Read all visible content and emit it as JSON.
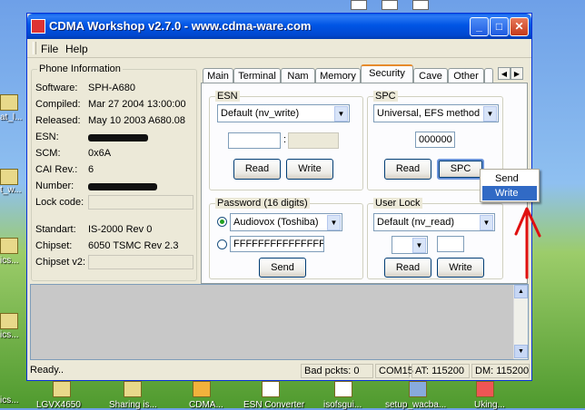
{
  "window": {
    "title": "CDMA Workshop v2.7.0  -  www.cdma-ware.com",
    "min_glyph": "_",
    "max_glyph": "□",
    "close_glyph": "✕"
  },
  "menu": {
    "file": "File",
    "help": "Help"
  },
  "phone_info": {
    "title": "Phone Information",
    "rows": [
      {
        "label": "Software:",
        "value": "SPH-A680"
      },
      {
        "label": "Compiled:",
        "value": "Mar 27 2004 13:00:00"
      },
      {
        "label": "Released:",
        "value": "May 10 2003 A680.08"
      },
      {
        "label": "ESN:",
        "value": ""
      },
      {
        "label": "SCM:",
        "value": "0x6A"
      },
      {
        "label": "CAI Rev.:",
        "value": "6"
      },
      {
        "label": "Number:",
        "value": ""
      },
      {
        "label": "Lock code:",
        "value": ""
      },
      {
        "label": "Standart:",
        "value": "IS-2000 Rev 0"
      },
      {
        "label": "Chipset:",
        "value": "6050 TSMC Rev 2.3"
      },
      {
        "label": "Chipset v2:",
        "value": ""
      }
    ]
  },
  "tabs": [
    "Main",
    "Terminal",
    "Nam",
    "Memory",
    "Security",
    "Cave",
    "Other"
  ],
  "active_tab": "Security",
  "tab_scroll": {
    "left": "◀",
    "right": "▶"
  },
  "esn_group": {
    "title": "ESN",
    "mode_selected": "Default (nv_write)",
    "separator": ":",
    "read_label": "Read",
    "write_label": "Write"
  },
  "spc_group": {
    "title": "SPC",
    "method_selected": "Universal, EFS method",
    "spc_value": "000000",
    "read_label": "Read",
    "spc_label": "SPC"
  },
  "password_group": {
    "title": "Password (16 digits)",
    "preset_selected": "Audiovox (Toshiba)",
    "custom_value": "FFFFFFFFFFFFFFFF",
    "send_label": "Send"
  },
  "user_lock_group": {
    "title": "User Lock",
    "mode_selected": "Default (nv_read)",
    "read_label": "Read",
    "write_label": "Write"
  },
  "context_menu": {
    "items": [
      "Send",
      "Write"
    ],
    "selected": "Write"
  },
  "statusbar": {
    "status": "Ready..",
    "bad_packets": "Bad pckts: 0",
    "port": "COM15",
    "at_baud": "AT: 115200",
    "dm_baud": "DM: 115200"
  },
  "colors": {
    "titlebar": "#0055e5",
    "window_bg": "#ece9d8",
    "selection": "#316ac5",
    "annotation_arrow": "#e01010"
  },
  "taskbar_labels": [
    "LGVX4650",
    "Sharing is...",
    "CDMA...",
    "ESN Converter",
    "isofsgui...",
    "setup_wacba...",
    "Uking..."
  ],
  "desktop_labels": [
    "at_l...",
    "t_w...",
    "ics...",
    "ics...",
    "ics..."
  ]
}
